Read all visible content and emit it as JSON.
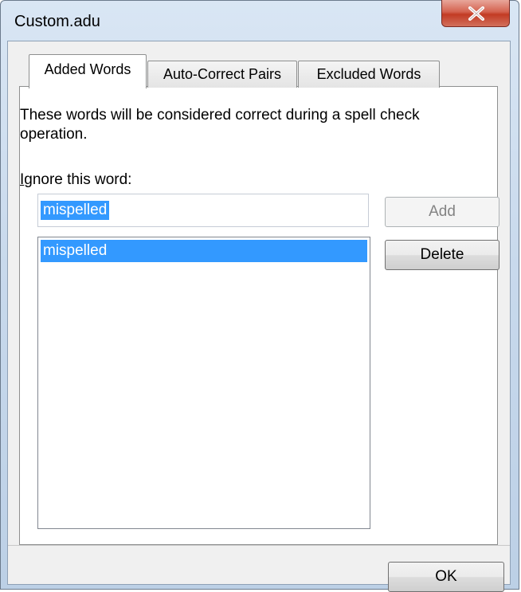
{
  "window": {
    "title": "Custom.adu"
  },
  "tabs": [
    {
      "label": "Added Words",
      "active": true
    },
    {
      "label": "Auto-Correct Pairs",
      "active": false
    },
    {
      "label": "Excluded Words",
      "active": false
    }
  ],
  "panel": {
    "description": "These words will be considered correct during a spell check operation.",
    "ignore_label_prefix": "I",
    "ignore_label_rest": "gnore this word:",
    "input_value": "mispelled",
    "list_items": [
      "mispelled"
    ],
    "add_label": "Add",
    "delete_label": "Delete"
  },
  "footer": {
    "ok_label": "OK"
  },
  "colors": {
    "selection": "#3399ff",
    "close_button": "#c23b24"
  },
  "icons": {
    "close": "close-x-icon"
  }
}
